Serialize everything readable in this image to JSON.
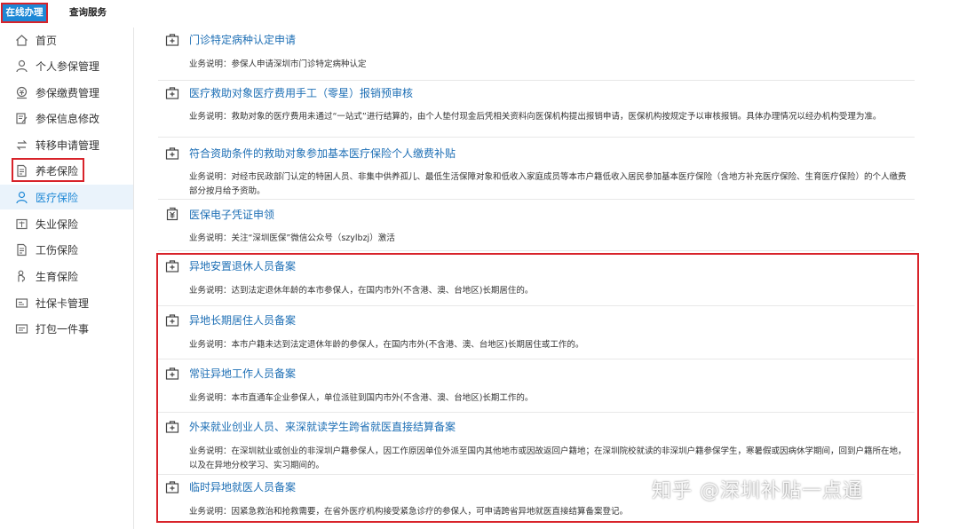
{
  "top_tabs": [
    {
      "label": "在线办理",
      "active": true
    },
    {
      "label": "查询服务",
      "active": false
    }
  ],
  "sidebar": {
    "items": [
      {
        "label": "首页",
        "icon": "home-icon"
      },
      {
        "label": "个人参保管理",
        "icon": "person-icon"
      },
      {
        "label": "参保缴费管理",
        "icon": "payment-icon"
      },
      {
        "label": "参保信息修改",
        "icon": "edit-icon"
      },
      {
        "label": "转移申请管理",
        "icon": "transfer-icon"
      },
      {
        "label": "养老保险",
        "icon": "document-icon"
      },
      {
        "label": "医疗保险",
        "icon": "medical-person-icon",
        "active": true
      },
      {
        "label": "失业保险",
        "icon": "unemployment-icon"
      },
      {
        "label": "工伤保险",
        "icon": "document-icon"
      },
      {
        "label": "生育保险",
        "icon": "maternity-icon"
      },
      {
        "label": "社保卡管理",
        "icon": "card-icon"
      },
      {
        "label": "打包一件事",
        "icon": "package-icon"
      }
    ]
  },
  "services": [
    {
      "title": "门诊特定病种认定申请",
      "desc": "业务说明：参保人申请深圳市门诊特定病种认定",
      "icon": "medkit-icon"
    },
    {
      "title": "医疗救助对象医疗费用手工（零星）报销预审核",
      "desc": "业务说明：救助对象的医疗费用未通过“一站式”进行结算的，由个人垫付现金后凭相关资料向医保机构提出报销申请，医保机构按规定予以审核报销。具体办理情况以经办机构受理为准。",
      "icon": "medkit-icon"
    },
    {
      "title": "符合资助条件的救助对象参加基本医疗保险个人缴费补贴",
      "desc": "业务说明：对经市民政部门认定的特困人员、非集中供养孤儿、最低生活保障对象和低收入家庭成员等本市户籍低收入居民参加基本医疗保险（含地方补充医疗保险、生育医疗保险）的个人缴费部分按月给予资助。",
      "icon": "medkit-icon"
    },
    {
      "title": "医保电子凭证申领",
      "desc": "业务说明：关注“深圳医保”微信公众号（szylbzj）激活",
      "icon": "voucher-icon"
    },
    {
      "title": "异地安置退休人员备案",
      "desc": "业务说明：达到法定退休年龄的本市参保人，在国内市外(不含港、澳、台地区)长期居住的。",
      "icon": "medkit-icon"
    },
    {
      "title": "异地长期居住人员备案",
      "desc": "业务说明：本市户籍未达到法定退休年龄的参保人，在国内市外(不含港、澳、台地区)长期居住或工作的。",
      "icon": "medkit-icon"
    },
    {
      "title": "常驻异地工作人员备案",
      "desc": "业务说明：本市直通车企业参保人，单位派驻到国内市外(不含港、澳、台地区)长期工作的。",
      "icon": "medkit-icon"
    },
    {
      "title": "外来就业创业人员、来深就读学生跨省就医直接结算备案",
      "desc": "业务说明：在深圳就业或创业的非深圳户籍参保人，因工作原因单位外派至国内其他地市或因故返回户籍地；在深圳院校就读的非深圳户籍参保学生，寒暑假或因病休学期间，回到户籍所在地，以及在异地分校学习、实习期间的。",
      "icon": "medkit-icon"
    },
    {
      "title": "临时异地就医人员备案",
      "desc": "业务说明：因紧急救治和抢救需要，在省外医疗机构接受紧急诊疗的参保人，可申请跨省异地就医直接结算备案登记。",
      "icon": "medkit-icon"
    }
  ],
  "watermark": "知乎 @深圳补贴一点通",
  "colors": {
    "accent": "#1e88d6",
    "highlight": "#d8232a",
    "title_link": "#1e6fb5"
  }
}
